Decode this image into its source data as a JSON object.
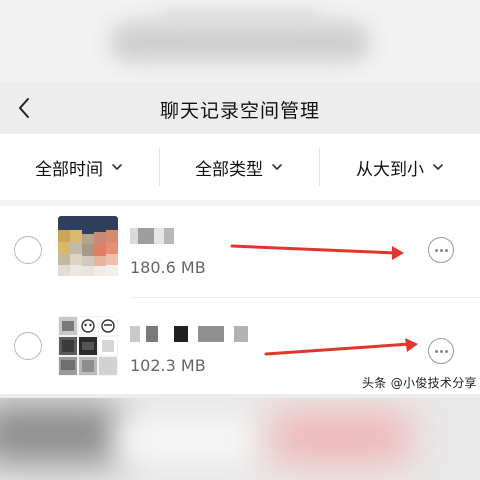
{
  "header": {
    "title": "聊天记录空间管理",
    "back_icon": "chevron-left-icon"
  },
  "filters": [
    {
      "label": "全部时间",
      "icon": "chevron-down-icon"
    },
    {
      "label": "全部类型",
      "icon": "chevron-down-icon"
    },
    {
      "label": "从大到小",
      "icon": "chevron-down-icon"
    }
  ],
  "chats": [
    {
      "size": "180.6 MB",
      "name_obscured": true
    },
    {
      "size": "102.3 MB",
      "name_obscured": true
    }
  ],
  "colors": {
    "annotation_arrow": "#e0362e",
    "radio_border": "#b8b8b8",
    "size_text": "#666666"
  },
  "watermark": "头条 @小俊技术分享"
}
